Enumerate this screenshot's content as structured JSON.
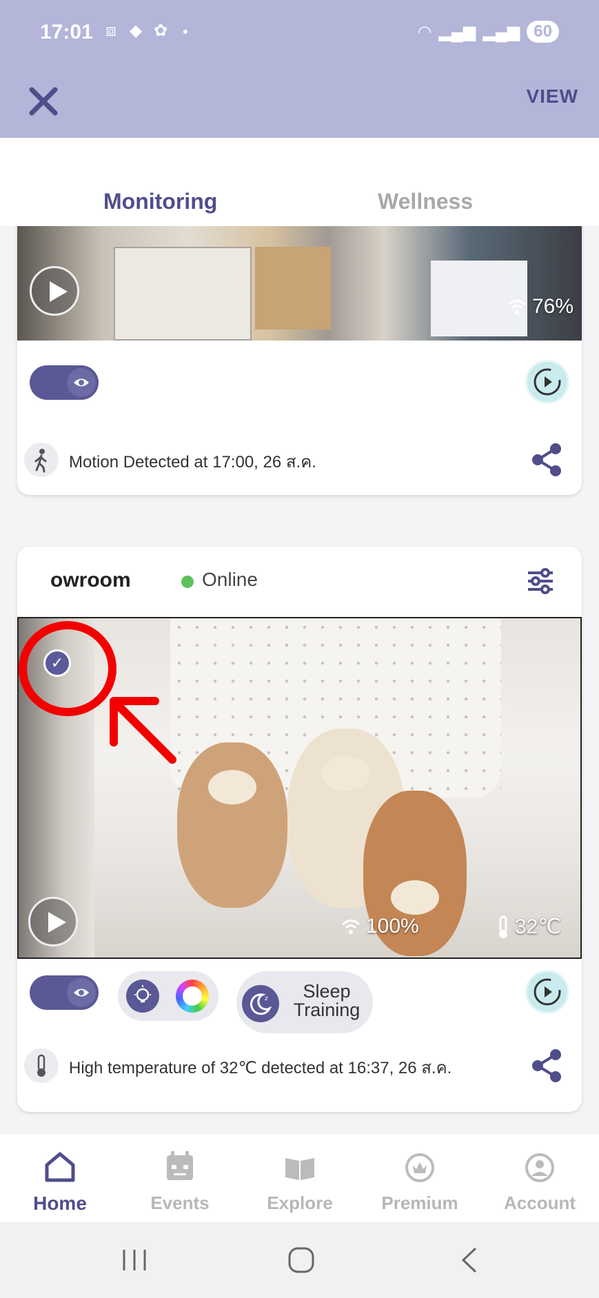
{
  "status_bar": {
    "time": "17:01",
    "battery": "60"
  },
  "header": {
    "close_label": "×",
    "view_label": "VIEW"
  },
  "tabs": [
    {
      "label": "Monitoring",
      "active": true
    },
    {
      "label": "Wellness",
      "active": false
    }
  ],
  "camera1": {
    "wifi": "76%",
    "event": "Motion Detected at 17:00, 26 ส.ค."
  },
  "camera2": {
    "name": "owroom",
    "status": "Online",
    "wifi": "100%",
    "temperature": "32℃",
    "sleep_label_line1": "Sleep",
    "sleep_label_line2": "Training",
    "event": "High temperature of 32℃ detected at 16:37, 26 ส.ค."
  },
  "bottom_nav": [
    {
      "label": "Home",
      "icon": "home-icon",
      "active": true
    },
    {
      "label": "Events",
      "icon": "calendar-icon",
      "active": false
    },
    {
      "label": "Explore",
      "icon": "book-icon",
      "active": false
    },
    {
      "label": "Premium",
      "icon": "premium-icon",
      "active": false
    },
    {
      "label": "Account",
      "icon": "account-icon",
      "active": false
    }
  ],
  "colors": {
    "header_bg": "#b3b5d9",
    "primary": "#4f4d8a",
    "online": "#5cc25a",
    "annotation_red": "#f20000"
  }
}
